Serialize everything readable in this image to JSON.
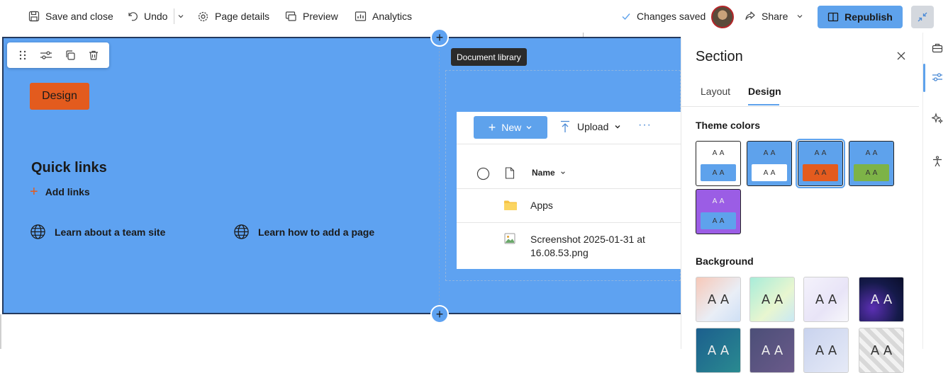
{
  "topbar": {
    "save_close": "Save and close",
    "undo": "Undo",
    "page_details": "Page details",
    "preview": "Preview",
    "analytics": "Analytics",
    "changes_saved": "Changes saved",
    "share": "Share",
    "republish": "Republish"
  },
  "canvas": {
    "design_label": "Design",
    "quick_links_title": "Quick links",
    "add_links": "Add links",
    "links": [
      "Learn about a team site",
      "Learn how to add a page"
    ],
    "tooltip": "Document library",
    "add_section_symbol": "+"
  },
  "doclib": {
    "new_label": "New",
    "upload_label": "Upload",
    "more_label": "···",
    "name_header": "Name",
    "rows": [
      {
        "name": "Apps",
        "type": "folder"
      },
      {
        "name_line1": "Screenshot 2025-01-31 at",
        "name_line2": "16.08.53.png",
        "type": "image"
      }
    ]
  },
  "panel": {
    "title": "Section",
    "tabs": [
      "Layout",
      "Design"
    ],
    "active_tab": "Design",
    "theme_colors_label": "Theme colors",
    "background_label": "Background",
    "aa_glyph": "A A",
    "themes": [
      {
        "top": "#ffffff",
        "swatch": "#5ea2ec",
        "selected": false
      },
      {
        "top": "#5ea2ec",
        "swatch": "#ffffff",
        "selected": false
      },
      {
        "top": "#5ea2ec",
        "swatch": "#e35b1e",
        "selected": true
      },
      {
        "top": "#5ea2ec",
        "swatch": "#7db347",
        "selected": false
      },
      {
        "top": "#9b5de5",
        "swatch": "#5ea2ec",
        "selected": false
      }
    ]
  },
  "colors": {
    "accent": "#5ea2ec",
    "canvas_bg": "#5ea2f1",
    "design_orange": "#e35b1e"
  }
}
